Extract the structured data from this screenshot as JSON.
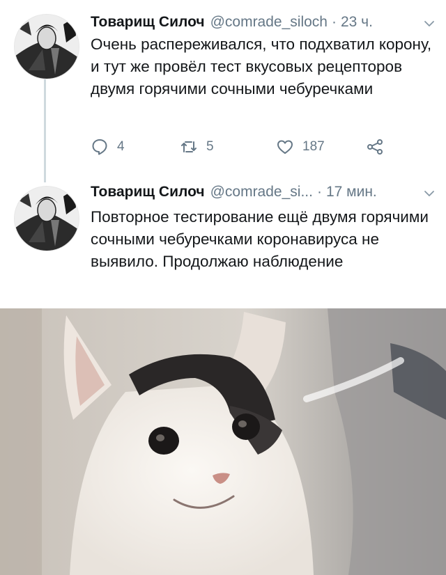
{
  "tweets": [
    {
      "name": "Товарищ Силоч",
      "handle": "@comrade_siloch",
      "separator": "·",
      "time": "23 ч.",
      "text": "Очень распереживался, что подхватил корону, и тут же провёл тест вкусовых рецепторов двумя горячими сочными чебуречками",
      "replies": "4",
      "retweets": "5",
      "likes": "187",
      "icons": [
        "reply-icon",
        "retweet-icon",
        "heart-icon",
        "share-icon"
      ]
    },
    {
      "name": "Товарищ Силоч",
      "handle": "@comrade_si...",
      "separator": "·",
      "time": "17 мин.",
      "text": "Повторное тестирование ещё двумя горячими сочными чебуречками коронавируса не выявило. Продолжаю наблюдение"
    }
  ],
  "colors": {
    "text": "#14171a",
    "muted": "#657786",
    "thread_line": "#cfd9de"
  }
}
